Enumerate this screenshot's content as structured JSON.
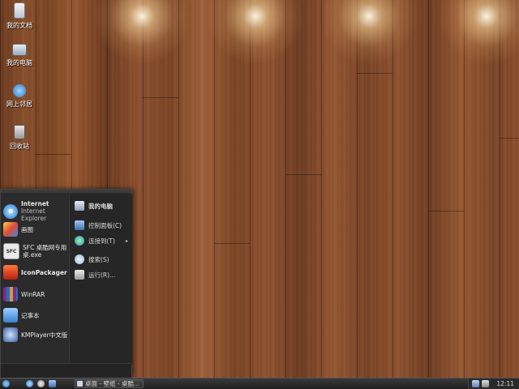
{
  "desktop_icons": [
    {
      "label": "我的文档",
      "icon": "my-documents-icon"
    },
    {
      "label": "我的电脑",
      "icon": "my-computer-icon"
    },
    {
      "label": "网上邻居",
      "icon": "network-places-icon"
    },
    {
      "label": "回收站",
      "icon": "recycle-bin-icon"
    }
  ],
  "start_menu": {
    "left_items": [
      {
        "title": "Internet",
        "subtitle": "Internet Explorer",
        "icon": "internet-explorer-icon"
      },
      {
        "title": "画图",
        "subtitle": "",
        "icon": "paint-icon"
      },
      {
        "title": "SFC 桌酷网专用",
        "subtitle": "桌.exe",
        "icon": "sfc-app-icon"
      },
      {
        "title": "IconPackager",
        "subtitle": "",
        "icon": "iconpackager-icon"
      },
      {
        "title": "WinRAR",
        "subtitle": "",
        "icon": "winrar-icon"
      },
      {
        "title": "记事本",
        "subtitle": "",
        "icon": "notepad-icon"
      },
      {
        "title": "KMPlayer中文版",
        "subtitle": "",
        "icon": "kmplayer-icon"
      }
    ],
    "right_items": [
      {
        "label": "我的电脑",
        "icon": "my-computer-icon"
      },
      {
        "label": "控制面板(C)",
        "icon": "control-panel-icon"
      },
      {
        "label": "连接到(T)",
        "icon": "connect-to-icon",
        "submenu_arrow": "▸"
      },
      {
        "label": "搜索(S)",
        "icon": "search-icon"
      },
      {
        "label": "运行(R)...",
        "icon": "run-icon"
      }
    ]
  },
  "taskbar": {
    "active_task": "桌面 - 壁纸 - 桌酷...",
    "clock": "12:11"
  }
}
